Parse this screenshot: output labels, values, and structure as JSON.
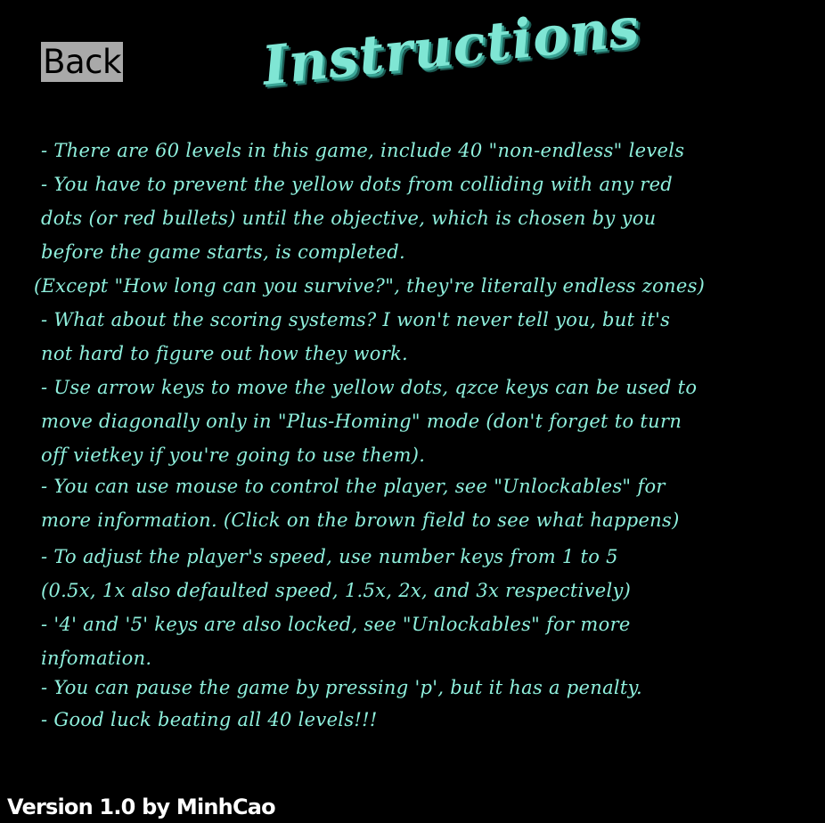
{
  "back_button": {
    "label": "Back"
  },
  "title": "Instructions",
  "instructions": [
    "- There are 60 levels in this game, include 40 \"non-endless\" levels",
    "- You have to prevent the yellow dots from colliding with any red",
    "dots (or red bullets) until the objective, which is chosen by you",
    "before the game starts, is completed.",
    "(Except \"How long can you survive?\", they're literally endless zones)",
    "- What about the scoring systems? I won't never tell you, but it's",
    "not hard to figure out how they work.",
    "- Use arrow keys to move the yellow dots, qzce keys can be used to",
    "move diagonally only in \"Plus-Homing\" mode (don't forget to turn",
    "off vietkey if you're going to use them).",
    "- You can use mouse to control the player, see \"Unlockables\" for",
    "more information. (Click on the brown field to see what happens)",
    "- To adjust the player's speed, use number keys from 1 to 5",
    "(0.5x,  1x also defaulted speed,  1.5x,  2x,  and 3x respectively)",
    "- '4' and '5' keys are also locked, see \"Unlockables\" for more",
    "infomation.",
    "- You can pause the game by pressing 'p', but it has a penalty.",
    "- Good luck beating all 40 levels!!!"
  ],
  "version": "Version 1.0 by MinhCao",
  "colors": {
    "background": "#000000",
    "title": "#7fe6d4",
    "instruction_text": "#8ff0dd",
    "back_button_bg": "#a9a9a9",
    "version_text": "#ffffff"
  }
}
